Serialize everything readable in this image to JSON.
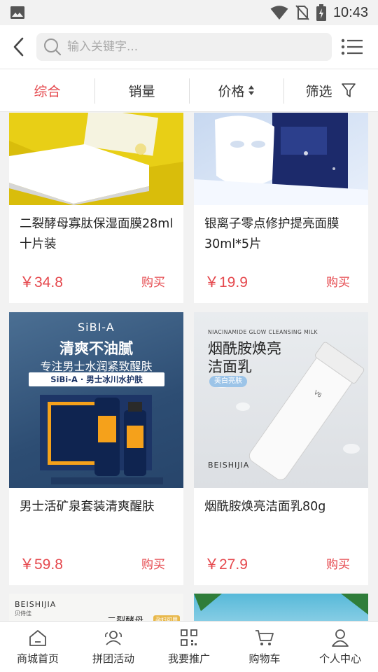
{
  "status_bar": {
    "time": "10:43",
    "icons": [
      "gallery-icon",
      "wifi-icon",
      "no-sim-icon",
      "battery-charging-icon"
    ]
  },
  "header": {
    "search_placeholder": "输入关键字...",
    "icons": [
      "back-icon",
      "search-icon",
      "list-menu-icon"
    ]
  },
  "sort_bar": {
    "items": [
      {
        "label": "综合",
        "active": true
      },
      {
        "label": "销量",
        "active": false
      },
      {
        "label": "价格",
        "active": false,
        "icon": "sort-arrows-icon"
      },
      {
        "label": "筛选",
        "active": false,
        "icon": "filter-icon"
      }
    ],
    "active_color": "#e5484d"
  },
  "products": [
    {
      "name": "二裂酵母寡肽保湿面膜28ml十片装",
      "price": "￥34.8",
      "buy_label": "购买",
      "image": "yellow-mask-pack"
    },
    {
      "name": "银离子零点修护提亮面膜30ml*5片",
      "price": "￥19.9",
      "buy_label": "购买",
      "image": "white-sheet-mask"
    },
    {
      "name": "男士活矿泉套装清爽醒肤",
      "price": "￥59.8",
      "buy_label": "购买",
      "image": "mens-skincare-set",
      "image_text": {
        "brand": "SiBI-A",
        "headline": "清爽不油腻",
        "subline": "专注男士水润紧致醒肤",
        "band": "SiBi-A · 男士冰川水护肤"
      }
    },
    {
      "name": "烟酰胺焕亮洁面乳80g",
      "price": "￥27.9",
      "buy_label": "购买",
      "image": "cleanser-tube",
      "image_text": {
        "top": "NIACINAMIDE GLOW CLEANSING MILK",
        "title1": "烟酰胺焕亮",
        "title2": "洁面乳",
        "tag": "美白亮肤",
        "brand": "BEISHIJIA"
      }
    },
    {
      "image": "beishijia-product",
      "image_text": {
        "brand": "BEISHIJIA",
        "brand_cn": "贝侍佳",
        "title": "二裂酵母",
        "tag": "孕妇可用"
      }
    },
    {
      "image": "aqua-product"
    }
  ],
  "bottom_nav": [
    {
      "label": "商城首页",
      "icon": "home-icon"
    },
    {
      "label": "拼团活动",
      "icon": "group-icon"
    },
    {
      "label": "我要推广",
      "icon": "qr-code-icon"
    },
    {
      "label": "购物车",
      "icon": "cart-icon"
    },
    {
      "label": "个人中心",
      "icon": "user-icon"
    }
  ],
  "colors": {
    "accent": "#e5484d",
    "background": "#f2f2f2"
  }
}
